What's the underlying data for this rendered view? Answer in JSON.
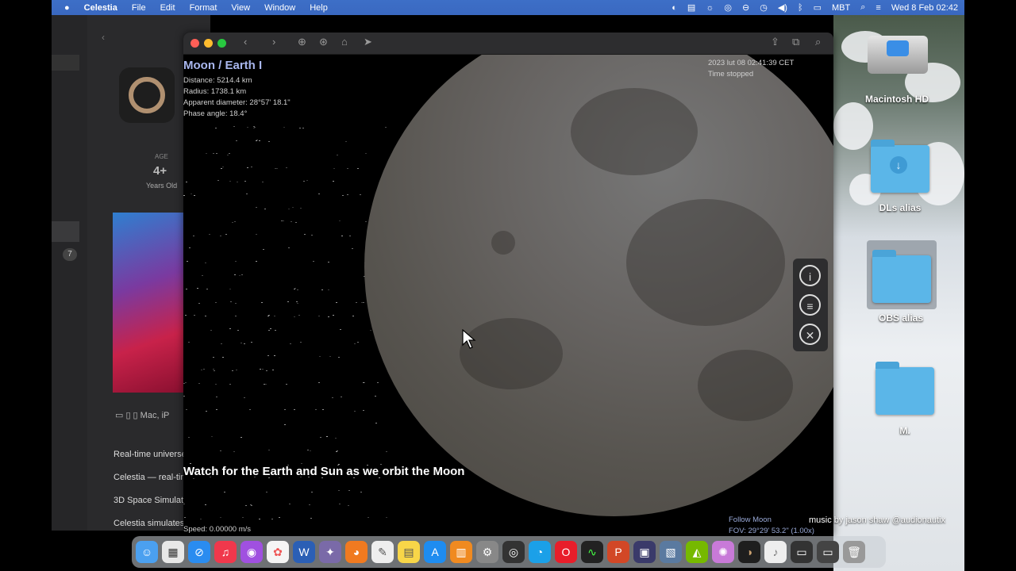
{
  "menubar": {
    "apple_icon": "apple-icon",
    "app_name": "Celestia",
    "items": [
      "File",
      "Edit",
      "Format",
      "View",
      "Window",
      "Help"
    ],
    "status": {
      "keyboard": "MBT",
      "datetime": "Wed 8 Feb  02:42"
    }
  },
  "bg_window": {
    "age_label": "AGE",
    "age_value": "4+",
    "age_sub": "Years Old",
    "badge": "7",
    "devices": "Mac, iP",
    "lines": [
      "Real-time universe",
      "Celestia — real-tim",
      "3D Space Simulat",
      "Celestia simulates"
    ]
  },
  "window": {
    "object_name": "Moon / Earth I",
    "distance": "Distance: 5214.4 km",
    "radius": "Radius: 1738.1 km",
    "apparent_diameter": "Apparent diameter: 28°57' 18.1\"",
    "phase_angle": "Phase angle: 18.4°",
    "date": "2023 lut 08 02:41:39 CET",
    "time_status": "Time stopped",
    "caption": "Watch for the Earth and Sun as we orbit the Moon",
    "speed": "Speed: 0.00000 m/s",
    "follow": "Follow Moon",
    "fov": "FOV: 29°29' 53.2\" (1.00x)"
  },
  "desktop": {
    "icons": [
      {
        "label": "Macintosh HD",
        "icon": "hard-drive-icon"
      },
      {
        "label": "DLs alias",
        "icon": "folder-alias-icon"
      },
      {
        "label": "OBS alias",
        "icon": "folder-alias-icon"
      },
      {
        "label": "M.",
        "icon": "folder-icon"
      }
    ]
  },
  "overlay": {
    "music_credit": "music by jason shaw @audionautix"
  },
  "colors": {
    "menubar": "#3d6fc7",
    "object_name": "#a9b7ee",
    "folder": "#5bb6e8"
  }
}
